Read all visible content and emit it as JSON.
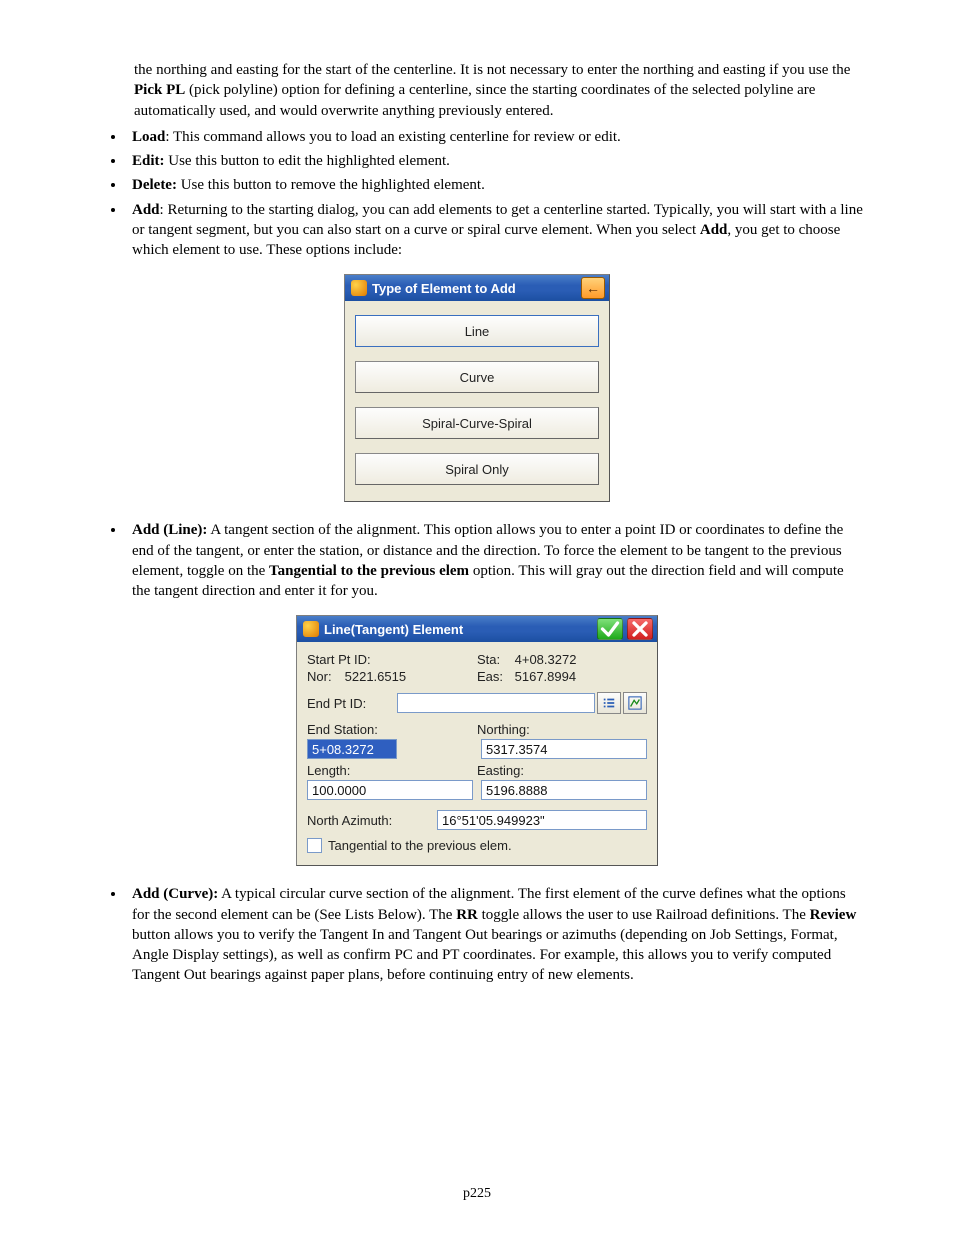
{
  "paragraphs": {
    "intro_cont": "the northing and easting for the start of the centerline.  It is not necessary to enter the northing and easting if you use the ",
    "intro_bold1": "Pick PL",
    "intro_cont2": " (pick polyline) option for defining a centerline, since the starting coordinates of the selected polyline are automatically used, and would overwrite anything previously entered."
  },
  "bullets1": {
    "load_b": "Load",
    "load_t": ":  This command allows you to load an existing centerline for review or edit.",
    "edit_b": "Edit:",
    "edit_t": " Use this button to edit the highlighted element.",
    "delete_b": "Delete:",
    "delete_t": " Use this button to remove the highlighted element.",
    "add_b": "Add",
    "add_t1": ":  Returning to the starting dialog, you can add elements to get a centerline started.  Typically, you will start with a line or tangent segment, but you can also start on a curve or spiral curve element.   When you select ",
    "add_b2": "Add",
    "add_t2": ", you get to choose which element to use.  These options include:"
  },
  "dlg1": {
    "title": "Type of Element to Add",
    "back": "←",
    "btn_line": "Line",
    "btn_curve": "Curve",
    "btn_scs": "Spiral-Curve-Spiral",
    "btn_spiral": "Spiral Only"
  },
  "bullets2": {
    "addline_b": "Add (Line):",
    "addline_t1": " A tangent section of the alignment. This option allows you to enter a point ID or coordinates to define the end of the tangent, or enter the station, or distance and the direction. To force the element to be tangent to the previous element, toggle on the ",
    "addline_b2": "Tangential to the previous elem",
    "addline_t2": " option. This will gray out the direction field and will compute the tangent direction and enter it for you."
  },
  "dlg2": {
    "title": "Line(Tangent) Element",
    "start_pt_id_lbl": "Start Pt ID:",
    "sta_lbl": "Sta:",
    "sta_val": "4+08.3272",
    "nor_lbl": "Nor:",
    "nor_val": "5221.6515",
    "eas_lbl": "Eas:",
    "eas_val": "5167.8994",
    "end_pt_id_lbl": "End Pt ID:",
    "end_pt_id_val": "",
    "end_station_lbl": "End Station:",
    "end_station_val": "5+08.3272",
    "northing_lbl": "Northing:",
    "northing_val": "5317.3574",
    "length_lbl": "Length:",
    "length_val": "100.0000",
    "easting_lbl": "Easting:",
    "easting_val": "5196.8888",
    "naz_lbl": "North Azimuth:",
    "naz_val": "16°51'05.949923\"",
    "tang_chk_lbl": "Tangential to the previous elem."
  },
  "bullets3": {
    "addcurve_b": "Add (Curve):",
    "addcurve_t1": " A typical circular curve section of the alignment. The first element of the curve defines what the options for the second element can be (See Lists Below). The ",
    "addcurve_b2": "RR",
    "addcurve_t2": " toggle allows the user to use Railroad definitions. The ",
    "addcurve_b3": "Review",
    "addcurve_t3": " button allows you to verify the Tangent In and Tangent Out bearings or azimuths (depending on Job Settings, Format, Angle Display settings), as well as confirm PC and PT coordinates.  For example, this allows you to verify computed Tangent Out bearings against paper plans, before continuing entry of new elements."
  },
  "footer": "p225"
}
